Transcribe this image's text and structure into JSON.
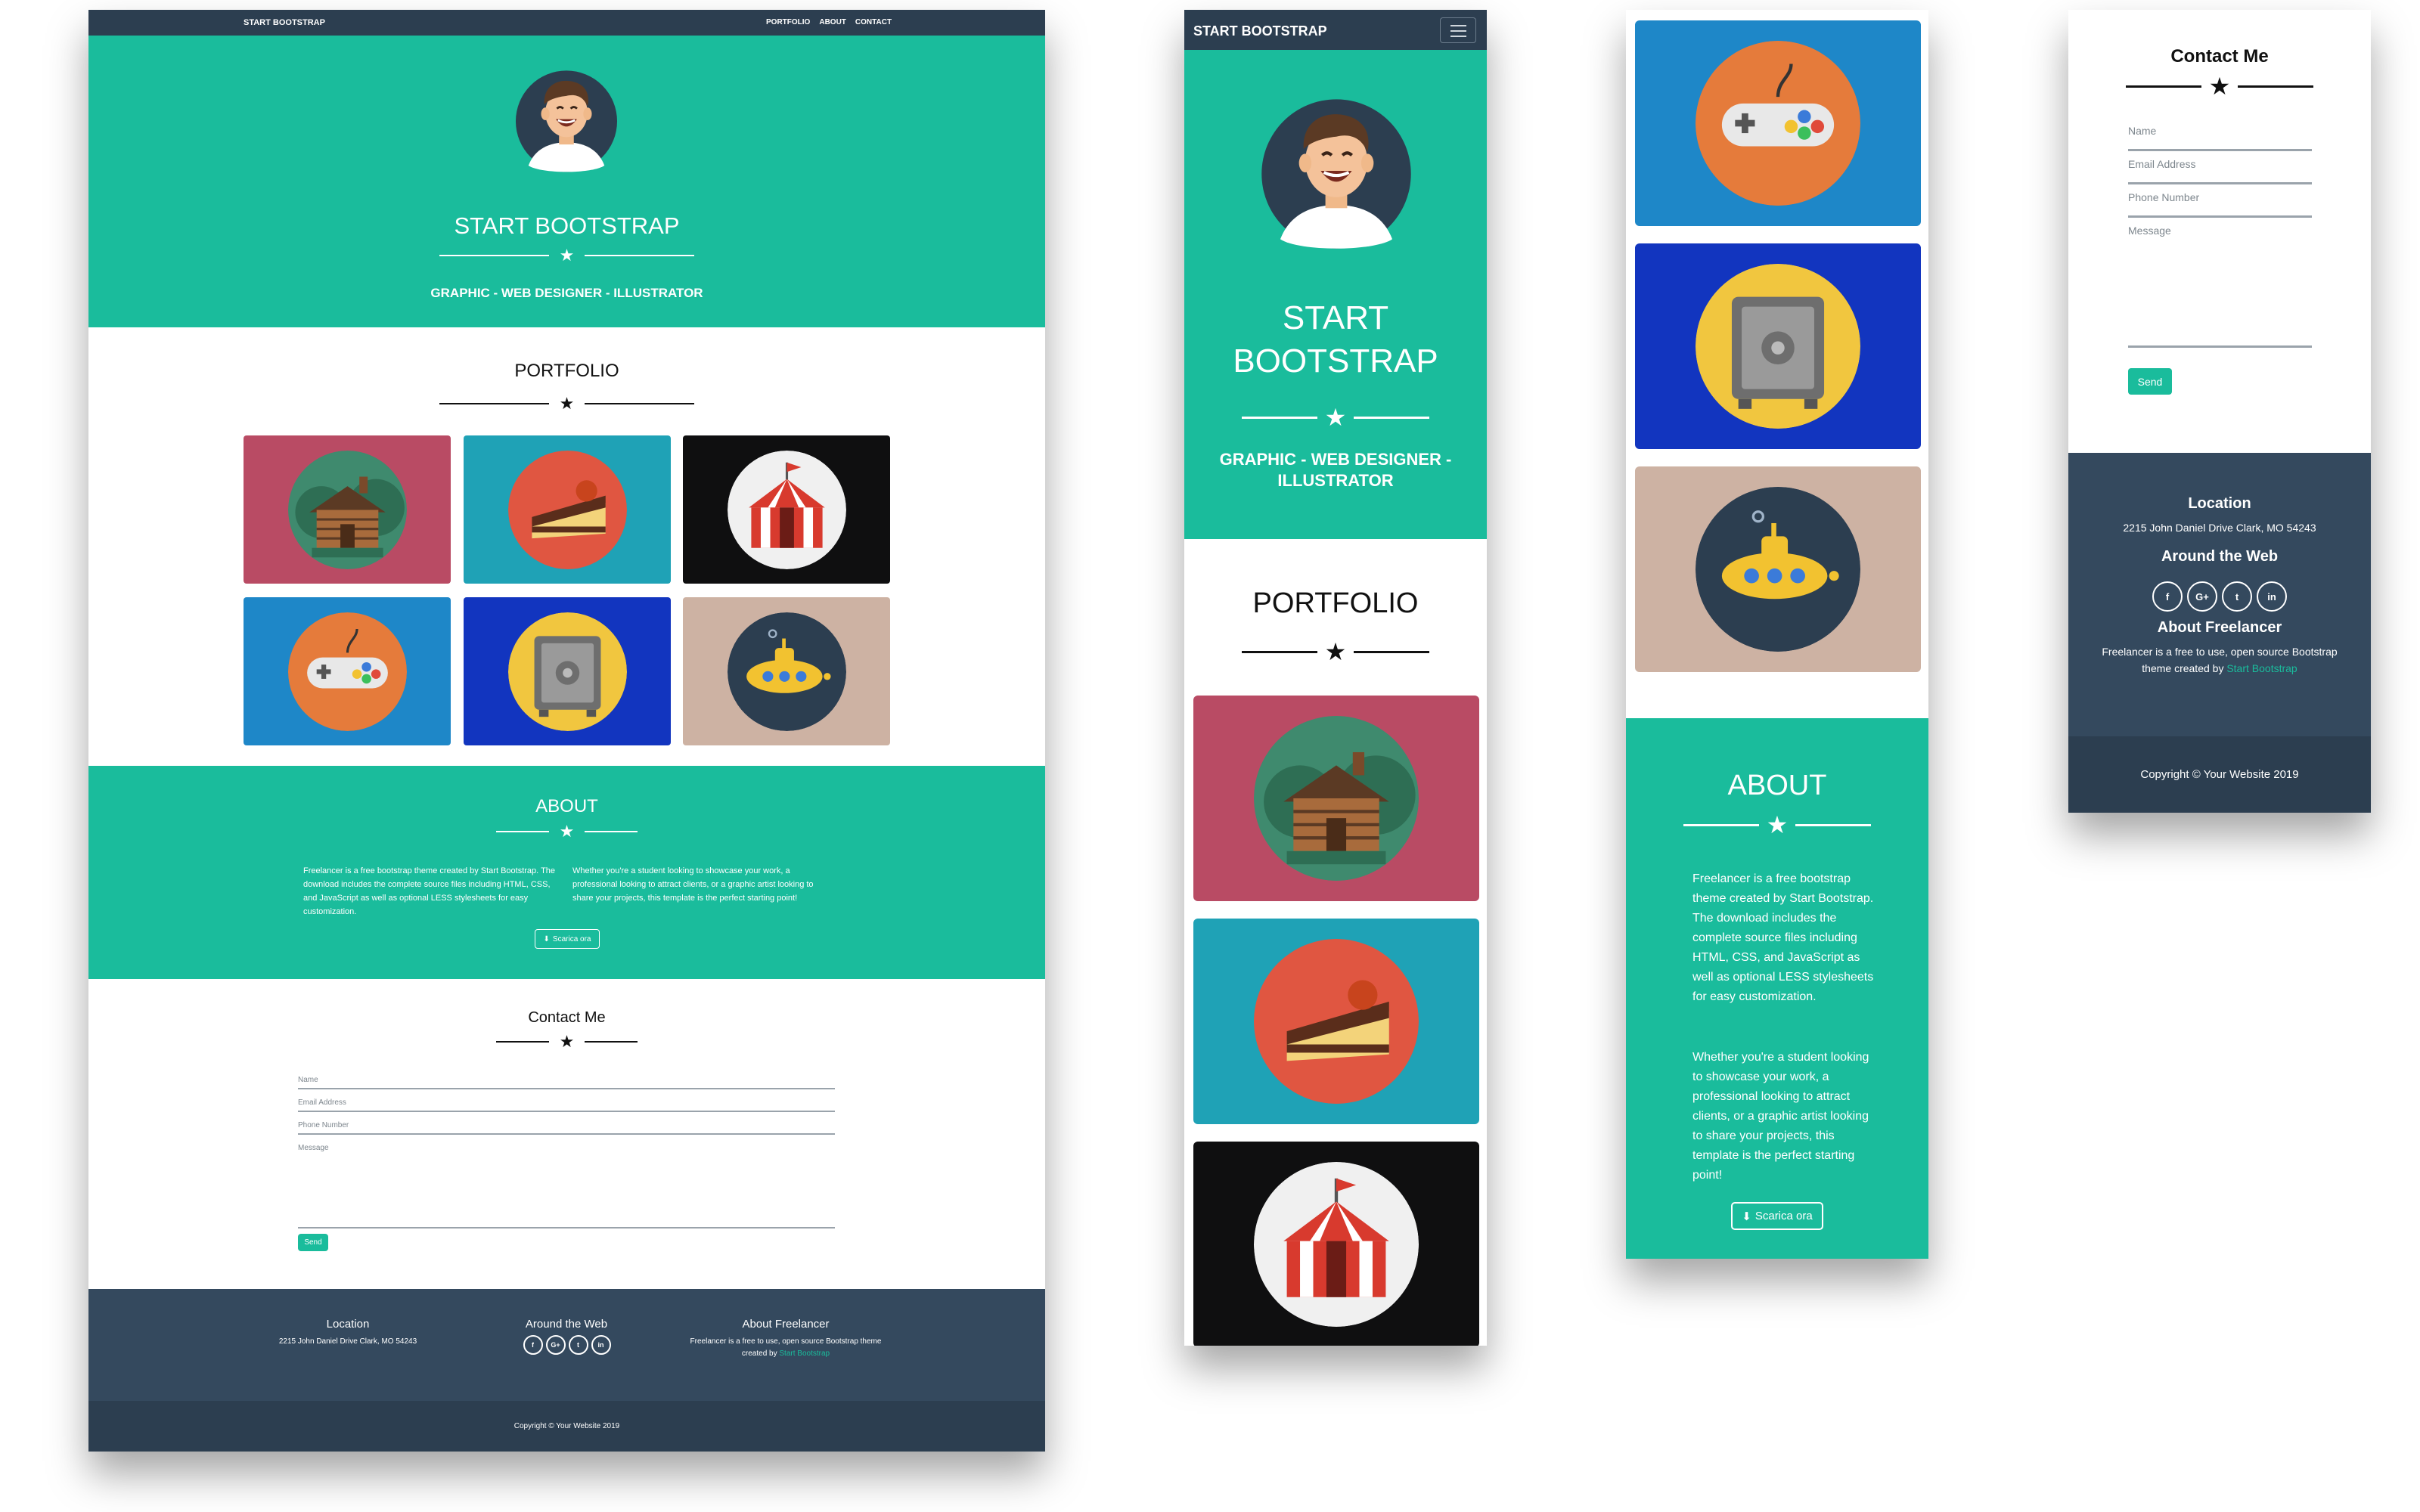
{
  "brand": "START BOOTSTRAP",
  "nav": {
    "links": [
      "PORTFOLIO",
      "ABOUT",
      "CONTACT"
    ],
    "menu_icon": "hamburger-icon"
  },
  "hero": {
    "title": "START BOOTSTRAP",
    "mobile_title_line1": "START",
    "mobile_title_line2": "BOOTSTRAP",
    "subtitle": "GRAPHIC - WEB DESIGNER - ILLUSTRATOR",
    "mobile_subtitle_line1": "GRAPHIC - WEB DESIGNER -",
    "mobile_subtitle_line2": "ILLUSTRATOR",
    "avatar_icon": "smiling-man-avatar"
  },
  "portfolio": {
    "title": "PORTFOLIO",
    "items": [
      {
        "icon": "log-cabin-icon",
        "bg": "#b94b64",
        "disc": "#3f8a6e"
      },
      {
        "icon": "cake-slice-icon",
        "bg": "#1fa2b6",
        "disc": "#e05641"
      },
      {
        "icon": "circus-tent-icon",
        "bg": "#0f0f10",
        "disc": "#f0f0f0"
      },
      {
        "icon": "game-controller-icon",
        "bg": "#1e87c8",
        "disc": "#e57b3b"
      },
      {
        "icon": "safe-icon",
        "bg": "#1235bf",
        "disc": "#f1c63f"
      },
      {
        "icon": "submarine-icon",
        "bg": "#cdb2a3",
        "disc": "#2c3e50"
      }
    ]
  },
  "about": {
    "title": "ABOUT",
    "left": "Freelancer is a free bootstrap theme created by Start Bootstrap. The download includes the complete source files including HTML, CSS, and JavaScript as well as optional LESS stylesheets for easy customization.",
    "right": "Whether you're a student looking to showcase your work, a professional looking to attract clients, or a graphic artist looking to share your projects, this template is the perfect starting point!",
    "button": "Scarica ora",
    "button_icon": "download-icon"
  },
  "contact": {
    "title": "Contact Me",
    "fields": {
      "name": "Name",
      "email": "Email Address",
      "phone": "Phone Number",
      "message": "Message"
    },
    "send": "Send"
  },
  "footer": {
    "location_title": "Location",
    "address": "2215 John Daniel Drive Clark, MO 54243",
    "web_title": "Around the Web",
    "socials": [
      {
        "icon": "facebook-icon",
        "glyph": "f"
      },
      {
        "icon": "google-plus-icon",
        "glyph": "G+"
      },
      {
        "icon": "twitter-icon",
        "glyph": "t"
      },
      {
        "icon": "linkedin-icon",
        "glyph": "in"
      }
    ],
    "about_title": "About Freelancer",
    "about_text": "Freelancer is a free to use, open source Bootstrap theme created by",
    "about_link": "Start Bootstrap",
    "copyright": "Copyright © Your Website 2019"
  },
  "colors": {
    "primary": "#1abc9c",
    "dark": "#2c3e50",
    "footer": "#34495e"
  }
}
